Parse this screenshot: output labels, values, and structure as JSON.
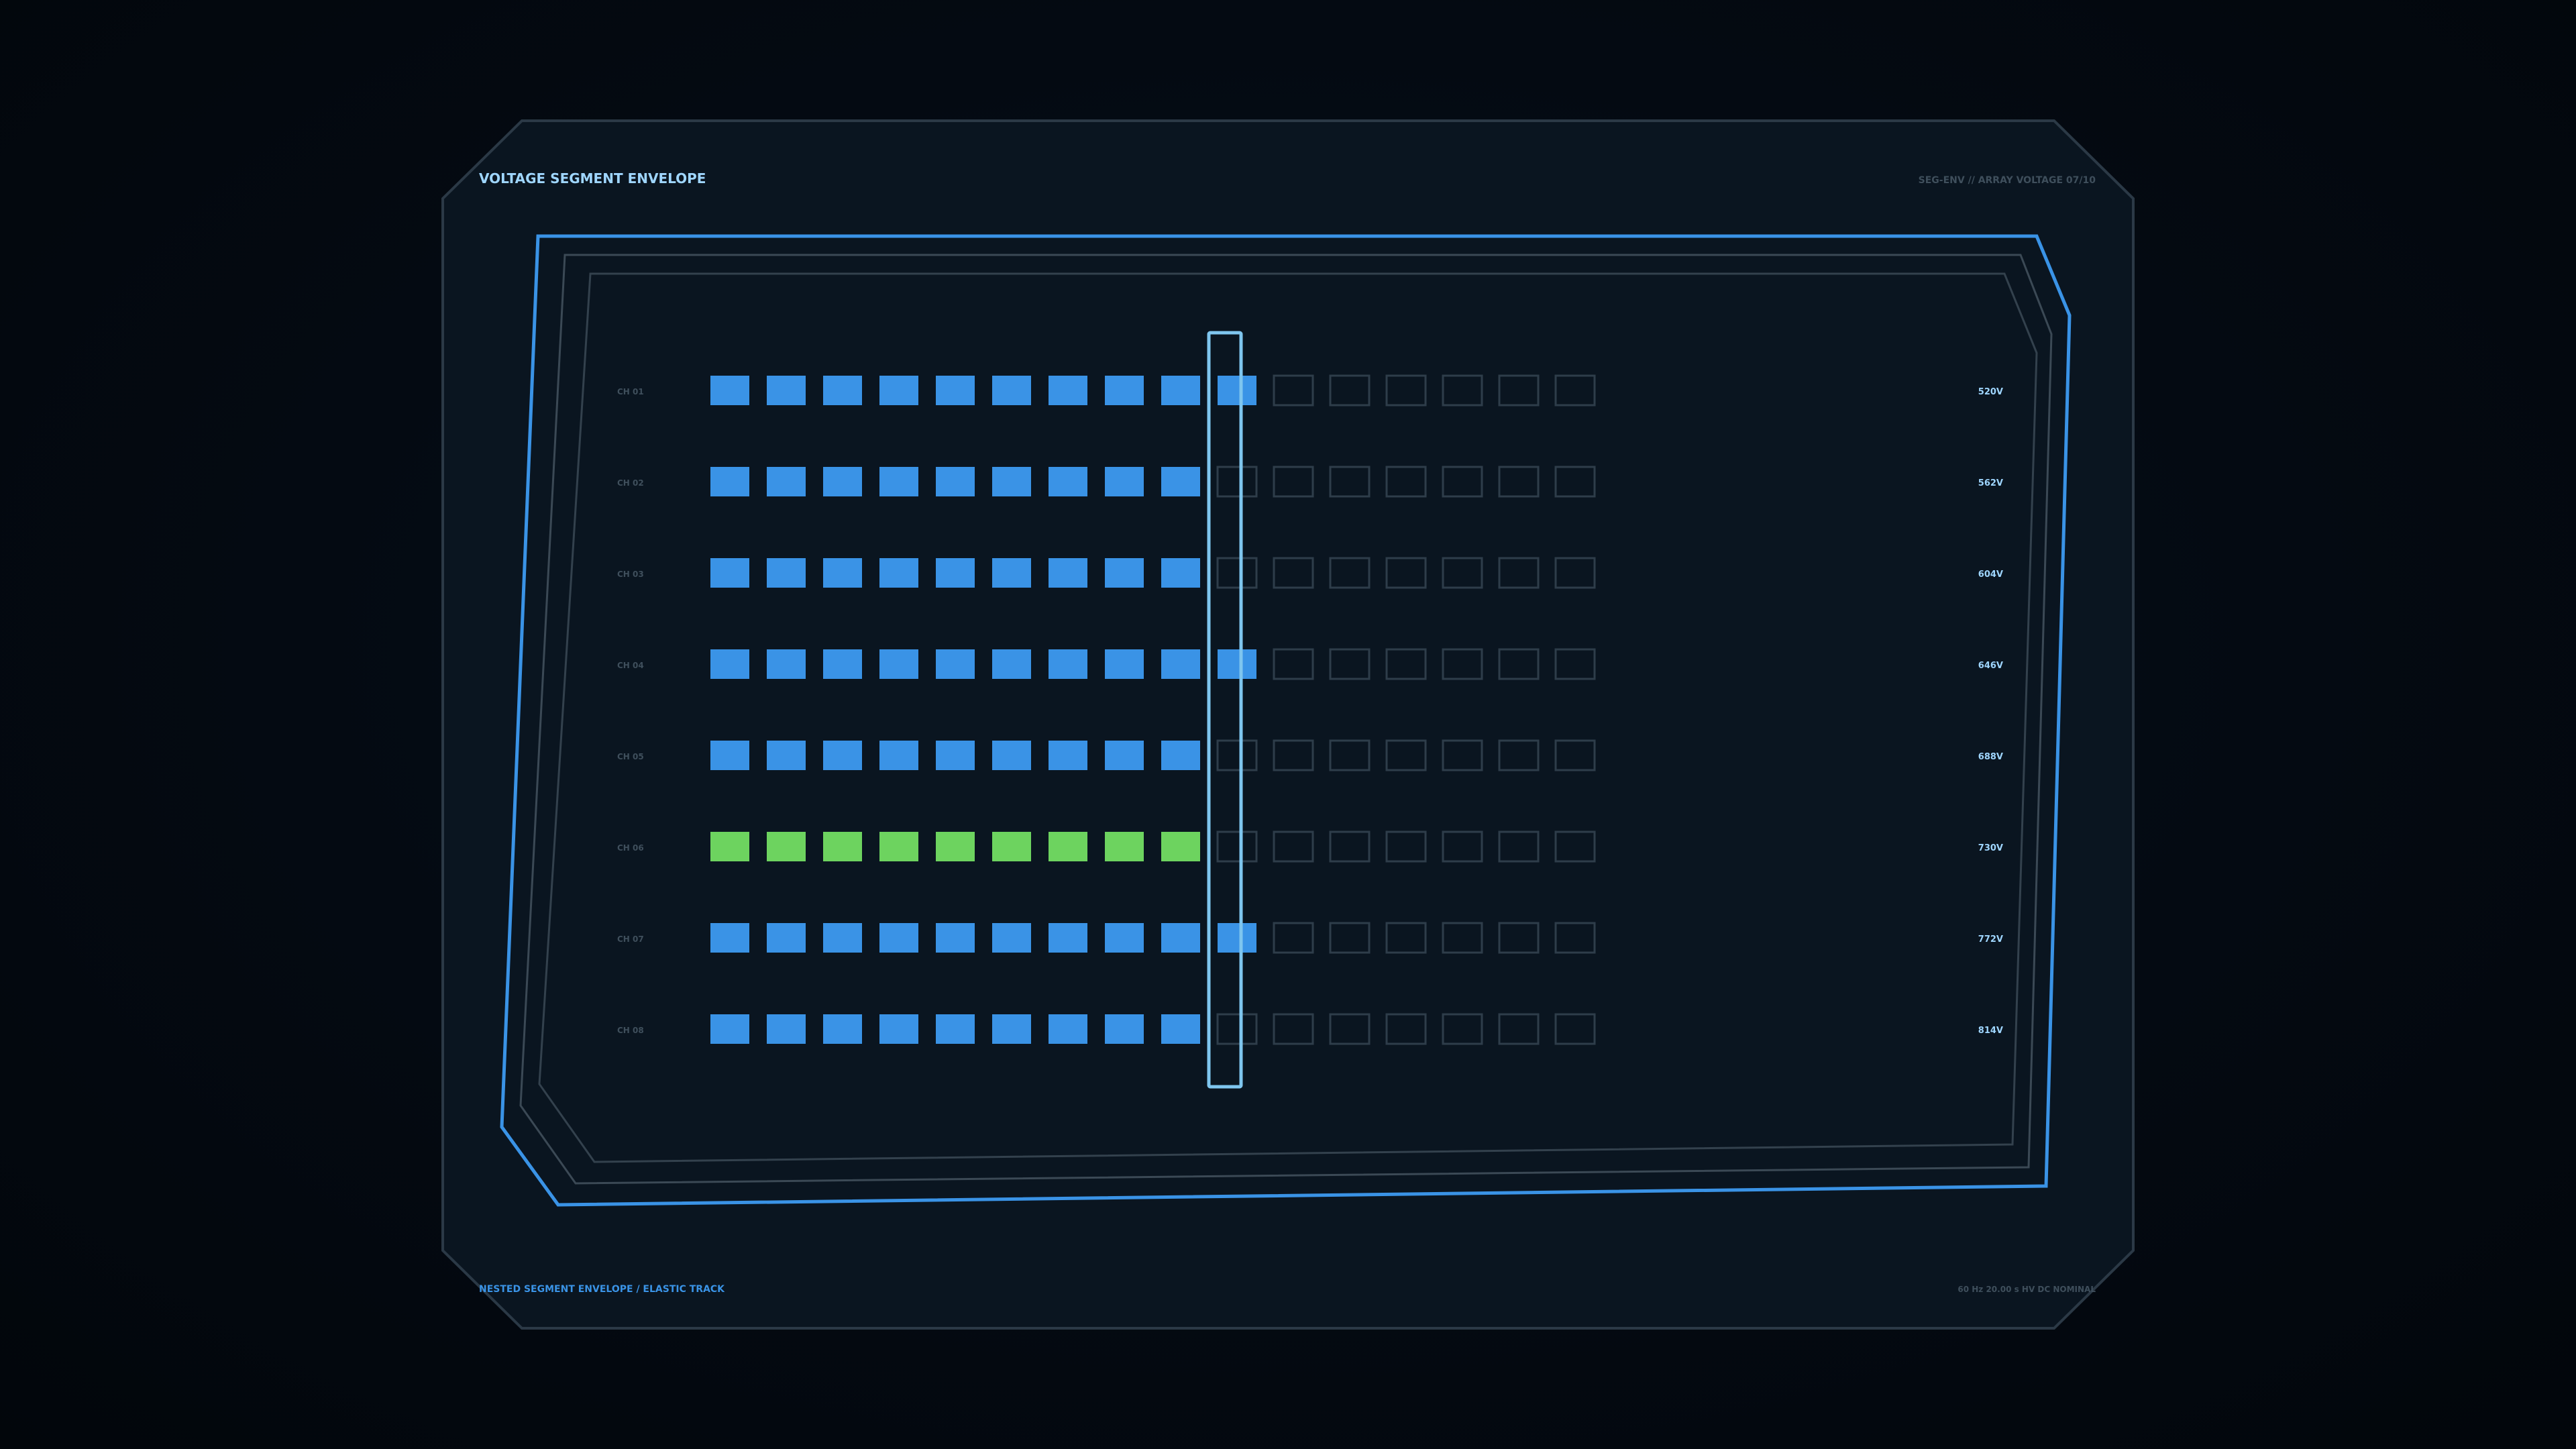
{
  "panel": {
    "title": "VOLTAGE SEGMENT ENVELOPE",
    "subtitle": "SEG-ENV // ARRAY VOLTAGE 07/10",
    "footer_left": "NESTED SEGMENT ENVELOPE / ELASTIC TRACK",
    "footer_right": "60 Hz  20.00 s  HV DC NOMINAL"
  },
  "colors": {
    "accent": "#3a93e6",
    "highlight": "#6dd35f",
    "empty": "#2e3d4a",
    "cursor": "#7fc6ef",
    "title": "#9fd6ff",
    "label_dim": "#3f4f5c"
  },
  "meter": {
    "segments_per_row": 16,
    "cursor_segment": 10,
    "rows": [
      {
        "label": "CH 01",
        "filled": 10,
        "value": "520V",
        "color": "blue"
      },
      {
        "label": "CH 02",
        "filled": 9,
        "value": "562V",
        "color": "blue"
      },
      {
        "label": "CH 03",
        "filled": 9,
        "value": "604V",
        "color": "blue"
      },
      {
        "label": "CH 04",
        "filled": 10,
        "value": "646V",
        "color": "blue"
      },
      {
        "label": "CH 05",
        "filled": 9,
        "value": "688V",
        "color": "blue"
      },
      {
        "label": "CH 06",
        "filled": 9,
        "value": "730V",
        "color": "green"
      },
      {
        "label": "CH 07",
        "filled": 10,
        "value": "772V",
        "color": "blue"
      },
      {
        "label": "CH 08",
        "filled": 9,
        "value": "814V",
        "color": "blue"
      }
    ]
  }
}
